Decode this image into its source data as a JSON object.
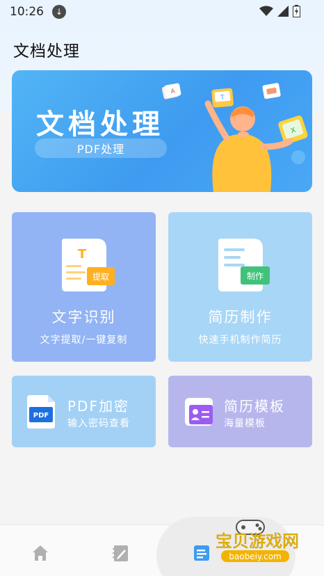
{
  "status_bar": {
    "time": "10:26"
  },
  "header": {
    "title": "文档处理"
  },
  "banner": {
    "title": "文档处理",
    "pill": "PDF处理"
  },
  "cards": {
    "ocr": {
      "title": "文字识别",
      "subtitle": "文字提取/一键复制",
      "badge": "提取",
      "icon_letter": "T"
    },
    "resume": {
      "title": "简历制作",
      "subtitle": "快速手机制作简历",
      "badge": "制作"
    },
    "pdf": {
      "title": "PDF加密",
      "subtitle": "输入密码查看",
      "icon_label": "PDF"
    },
    "template": {
      "title": "简历模板",
      "subtitle": "海量模板"
    }
  },
  "watermark": {
    "text": "宝贝游戏网",
    "url": "baobeiy.com"
  },
  "colors": {
    "banner": "#3e9bf0",
    "ocr_card": "#92b4f4",
    "resume_card": "#a8d6f6",
    "pdf_card": "#a3d1f5",
    "template_card": "#b7b6ec"
  },
  "icons": [
    "download-icon",
    "wifi-icon",
    "signal-icon",
    "battery-icon",
    "home-icon",
    "edit-icon",
    "document-icon"
  ]
}
